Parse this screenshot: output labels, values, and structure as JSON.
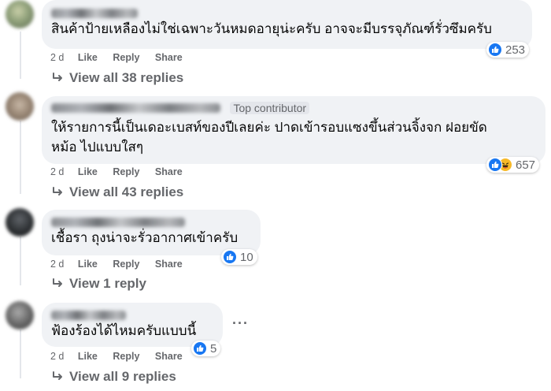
{
  "comments": [
    {
      "text": "สินค้าป้ายเหลืองไม่ใช่เฉพาะวันหมดอายุน่ะครับ อาจจะมีบรรจุภัณฑ์รั่วซึมครับ",
      "time": "2 d",
      "like": "Like",
      "reply": "Reply",
      "share": "Share",
      "reactions": [
        "like"
      ],
      "reaction_count": "253",
      "view_replies": "View all 38 replies"
    },
    {
      "badge": "Top contributor",
      "text_lines": [
        "ให้รายการนี้เป็นเดอะเบสท์ของปีเลยค่ะ ปาดเข้ารอบแซงขึ้นส่วนจิ้งจก ฝอยขัด",
        "หม้อ ไปแบบใสๆ"
      ],
      "time": "2 d",
      "like": "Like",
      "reply": "Reply",
      "share": "Share",
      "reactions": [
        "like",
        "haha"
      ],
      "reaction_count": "657",
      "view_replies": "View all 43 replies"
    },
    {
      "text": "เชื้อรา ถุงน่าจะรั่วอากาศเข้าครับ",
      "time": "2 d",
      "like": "Like",
      "reply": "Reply",
      "share": "Share",
      "reactions": [
        "like"
      ],
      "reaction_count": "10",
      "view_replies": "View 1 reply"
    },
    {
      "text": "ฟ้องร้องได้ไหมครับแบบนี้",
      "time": "2 d",
      "like": "Like",
      "reply": "Reply",
      "share": "Share",
      "reactions": [
        "like"
      ],
      "reaction_count": "5",
      "more_options": "···",
      "view_replies": "View all 9 replies"
    }
  ],
  "colors": {
    "bubble": "#f0f2f5",
    "like_blue": "#1877f2",
    "haha_yellow": "#f7b928",
    "meta_gray": "#65676b",
    "thread_line": "#e4e6eb"
  },
  "icons": {
    "like": "thumbs-up-icon",
    "haha": "laughing-face-icon",
    "reply_arrow": "reply-arrow-icon",
    "more": "more-options-icon"
  }
}
